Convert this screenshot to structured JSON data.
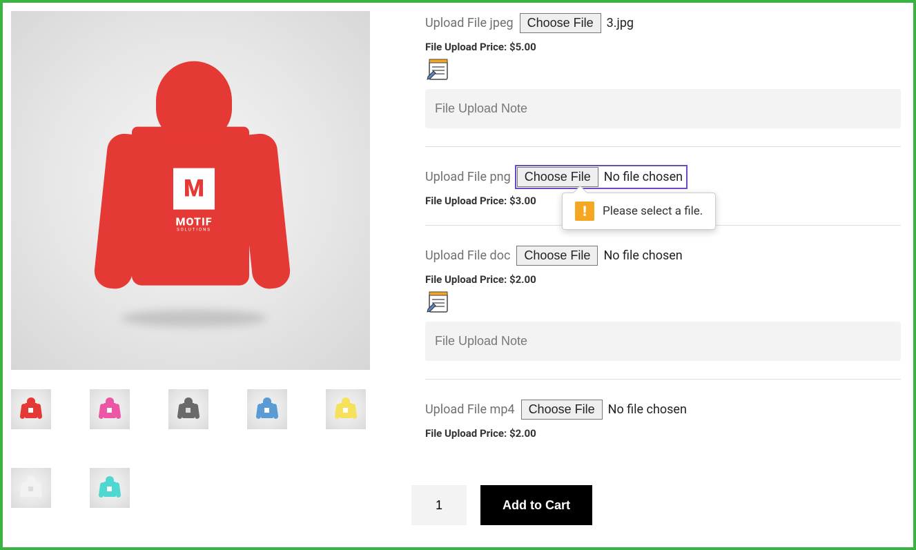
{
  "product": {
    "logo_letter": "M",
    "logo_text": "MOTIF",
    "logo_sub": "SOLUTIONS"
  },
  "thumbnails": [
    {
      "color": "red"
    },
    {
      "color": "pink"
    },
    {
      "color": "grey"
    },
    {
      "color": "blue"
    },
    {
      "color": "yellow"
    },
    {
      "color": "white"
    },
    {
      "color": "teal"
    }
  ],
  "uploads": {
    "jpeg": {
      "label": "Upload File jpeg",
      "choose": "Choose File",
      "file": "3.jpg",
      "price": "File Upload Price: $5.00",
      "note_placeholder": "File Upload Note"
    },
    "png": {
      "label": "Upload File png",
      "choose": "Choose File",
      "file": "No file chosen",
      "price": "File Upload Price: $3.00",
      "tooltip": "Please select a file."
    },
    "doc": {
      "label": "Upload File doc",
      "choose": "Choose File",
      "file": "No file chosen",
      "price": "File Upload Price: $2.00",
      "note_placeholder": "File Upload Note"
    },
    "mp4": {
      "label": "Upload File mp4",
      "choose": "Choose File",
      "file": "No file chosen",
      "price": "File Upload Price: $2.00"
    }
  },
  "cart": {
    "qty": "1",
    "add_label": "Add to Cart"
  }
}
